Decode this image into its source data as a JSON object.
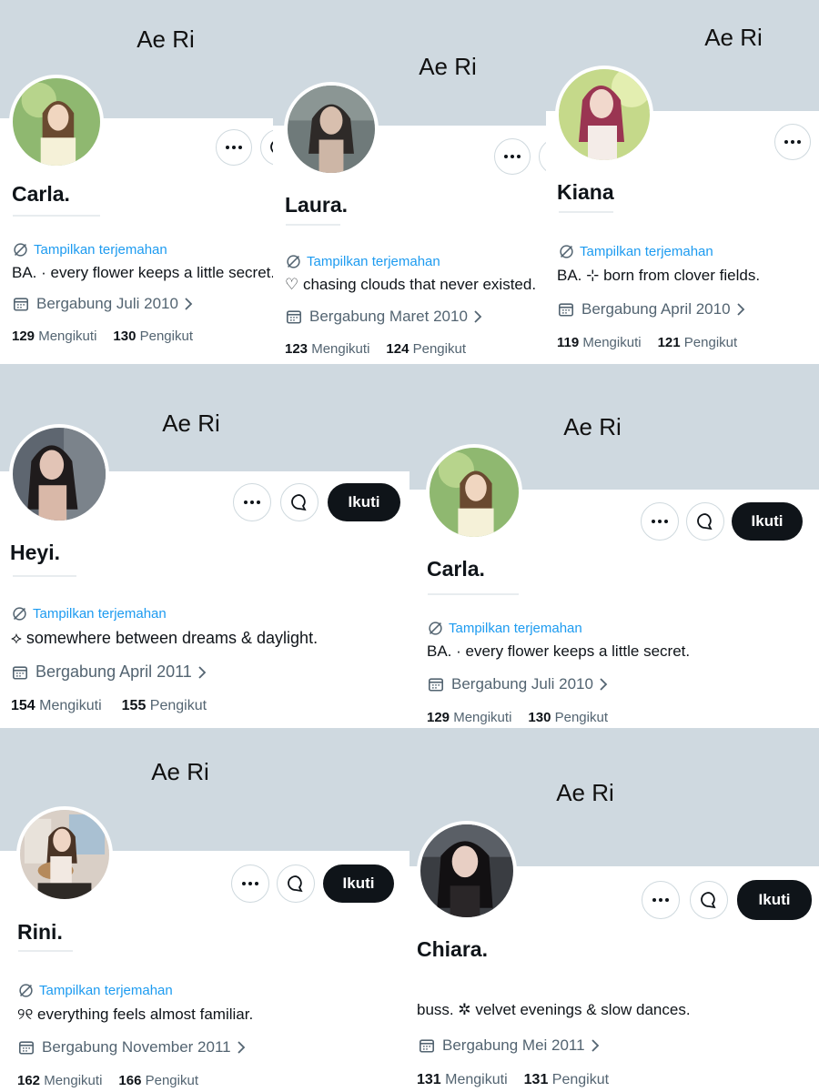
{
  "profiles": [
    {
      "banner_title": "Ae Ri",
      "name": "Carla.",
      "translate": "Tampilkan terjemahan",
      "bio": "BA. · every flower keeps a little secret.",
      "joined": "Bergabung Juli 2010",
      "following_count": "129",
      "following_label": "Mengikuti",
      "followers_count": "130",
      "followers_label": "Pengikut"
    },
    {
      "banner_title": "Ae Ri",
      "name": "Laura.",
      "translate": "Tampilkan terjemahan",
      "bio": "♡ chasing clouds that never existed.",
      "joined": "Bergabung Maret 2010",
      "following_count": "123",
      "following_label": "Mengikuti",
      "followers_count": "124",
      "followers_label": "Pengikut"
    },
    {
      "banner_title": "Ae Ri",
      "name": "Kiana",
      "translate": "Tampilkan terjemahan",
      "bio": "BA. ⊹ born from clover fields.",
      "joined": "Bergabung April 2010",
      "following_count": "119",
      "following_label": "Mengikuti",
      "followers_count": "121",
      "followers_label": "Pengikut"
    },
    {
      "banner_title": "Ae Ri",
      "name": "Heyi.",
      "translate": "Tampilkan terjemahan",
      "bio": "⟡ somewhere between dreams & daylight.",
      "joined": "Bergabung April 2011",
      "following_count": "154",
      "following_label": "Mengikuti",
      "followers_count": "155",
      "followers_label": "Pengikut",
      "follow_label": "Ikuti"
    },
    {
      "banner_title": "Ae Ri",
      "name": "Carla.",
      "translate": "Tampilkan terjemahan",
      "bio": "BA. · every flower keeps a little secret.",
      "joined": "Bergabung Juli 2010",
      "following_count": "129",
      "following_label": "Mengikuti",
      "followers_count": "130",
      "followers_label": "Pengikut",
      "follow_label": "Ikuti"
    },
    {
      "banner_title": "Ae Ri",
      "name": "Rini.",
      "translate": "Tampilkan terjemahan",
      "bio": "୨୧ everything feels almost familiar.",
      "joined": "Bergabung November 2011",
      "following_count": "162",
      "following_label": "Mengikuti",
      "followers_count": "166",
      "followers_label": "Pengikut",
      "follow_label": "Ikuti"
    },
    {
      "banner_title": "Ae Ri",
      "name": "Chiara.",
      "bio": "buss. ✲ velvet evenings & slow dances.",
      "joined": "Bergabung Mei 2011",
      "following_count": "131",
      "following_label": "Mengikuti",
      "followers_count": "131",
      "followers_label": "Pengikut",
      "follow_label": "Ikuti"
    }
  ],
  "icons": {
    "more": "more-icon",
    "message": "message-icon",
    "translate": "translate-icon",
    "calendar": "calendar-icon",
    "chevron": "chevron-right-icon"
  },
  "colors": {
    "banner": "#cfd9e0",
    "link": "#1d9bf0",
    "muted": "#536471",
    "text": "#0f1419",
    "button_dark": "#0f1419"
  }
}
